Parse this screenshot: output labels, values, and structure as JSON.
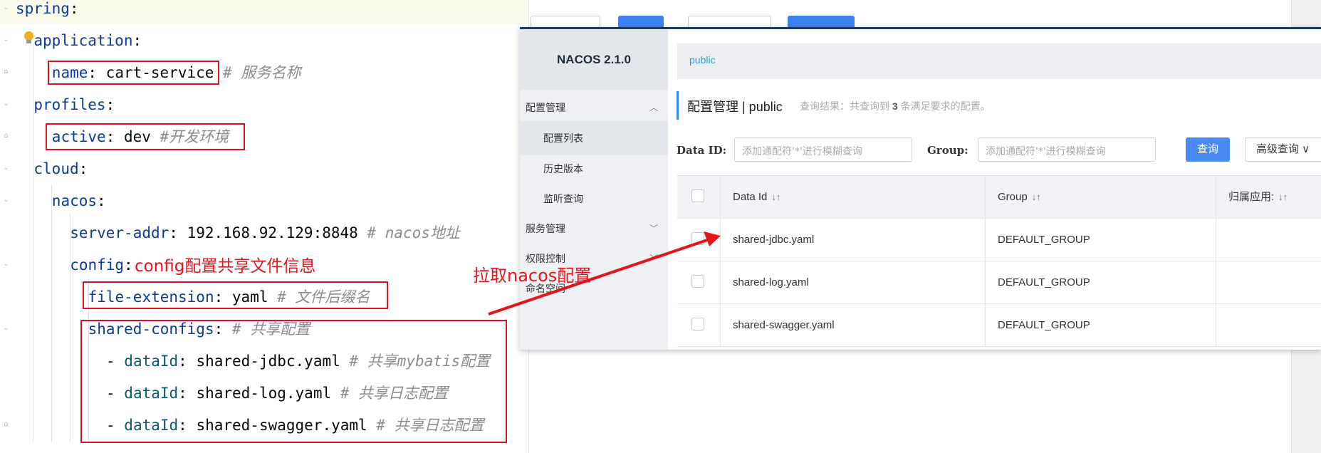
{
  "editor": {
    "lines": [
      {
        "indent": 0,
        "key": "spring",
        "sep": ":",
        "value": "",
        "comment": ""
      },
      {
        "indent": 1,
        "key": "application",
        "sep": ":",
        "value": "",
        "comment": ""
      },
      {
        "indent": 2,
        "key": "name",
        "sep": ": ",
        "value": "cart-service",
        "comment": " # 服务名称"
      },
      {
        "indent": 1,
        "key": "profiles",
        "sep": ":",
        "value": "",
        "comment": ""
      },
      {
        "indent": 2,
        "key": "active",
        "sep": ": ",
        "value": "dev",
        "comment": " #开发环境"
      },
      {
        "indent": 1,
        "key": "cloud",
        "sep": ":",
        "value": "",
        "comment": ""
      },
      {
        "indent": 2,
        "key": "nacos",
        "sep": ":",
        "value": "",
        "comment": ""
      },
      {
        "indent": 3,
        "key": "server-addr",
        "sep": ": ",
        "value": "192.168.92.129:8848",
        "comment": " # nacos地址"
      },
      {
        "indent": 3,
        "key": "config",
        "sep": ":",
        "value": "",
        "comment": ""
      },
      {
        "indent": 4,
        "key": "file-extension",
        "sep": ": ",
        "value": "yaml",
        "comment": " # 文件后缀名"
      },
      {
        "indent": 4,
        "key": "shared-configs",
        "sep": ":",
        "value": "",
        "comment": " # 共享配置"
      },
      {
        "indent": 5,
        "dash": "- ",
        "key": "dataId",
        "sep": ": ",
        "value": "shared-jdbc.yaml",
        "comment": " # 共享mybatis配置"
      },
      {
        "indent": 5,
        "dash": "- ",
        "key": "dataId",
        "sep": ": ",
        "value": "shared-log.yaml",
        "comment": " # 共享日志配置"
      },
      {
        "indent": 5,
        "dash": "- ",
        "key": "dataId",
        "sep": ": ",
        "value": "shared-swagger.yaml",
        "comment": " # 共享日志配置"
      }
    ],
    "config_note": "config配置共享文件信息"
  },
  "nacos": {
    "version": "NACOS 2.1.0",
    "menu": [
      {
        "label": "配置管理",
        "chevron": "︿",
        "sub": false,
        "active": false
      },
      {
        "label": "配置列表",
        "sub": true,
        "active": true
      },
      {
        "label": "历史版本",
        "sub": true,
        "active": false
      },
      {
        "label": "监听查询",
        "sub": true,
        "active": false
      },
      {
        "label": "服务管理",
        "chevron": "﹀",
        "sub": false,
        "active": false
      },
      {
        "label": "权限控制",
        "chevron": "﹀",
        "sub": false,
        "active": false
      },
      {
        "label": "命名空间",
        "sub": false,
        "active": false
      }
    ],
    "breadcrumb": "public",
    "title": "配置管理 | public",
    "result_prefix": "查询结果：共查询到 ",
    "result_count": "3",
    "result_suffix": " 条满足要求的配置。",
    "data_id_label": "Data ID:",
    "data_id_placeholder": "添加通配符'*'进行模糊查询",
    "group_label": "Group:",
    "group_placeholder": "添加通配符'*'进行模糊查询",
    "query_button": "查询",
    "advanced_query": "高级查询 ∨",
    "table": {
      "headers": [
        "Data Id",
        "Group",
        "归属应用:"
      ],
      "sort_icon": "↓↑",
      "rows": [
        {
          "data_id": "shared-jdbc.yaml",
          "group": "DEFAULT_GROUP"
        },
        {
          "data_id": "shared-log.yaml",
          "group": "DEFAULT_GROUP"
        },
        {
          "data_id": "shared-swagger.yaml",
          "group": "DEFAULT_GROUP"
        }
      ]
    }
  },
  "annotation": "拉取nacos配置",
  "colors": {
    "annotation_red": "#e5141b",
    "query_blue": "#4a8af4",
    "accent_blue": "#2f8ee8"
  }
}
